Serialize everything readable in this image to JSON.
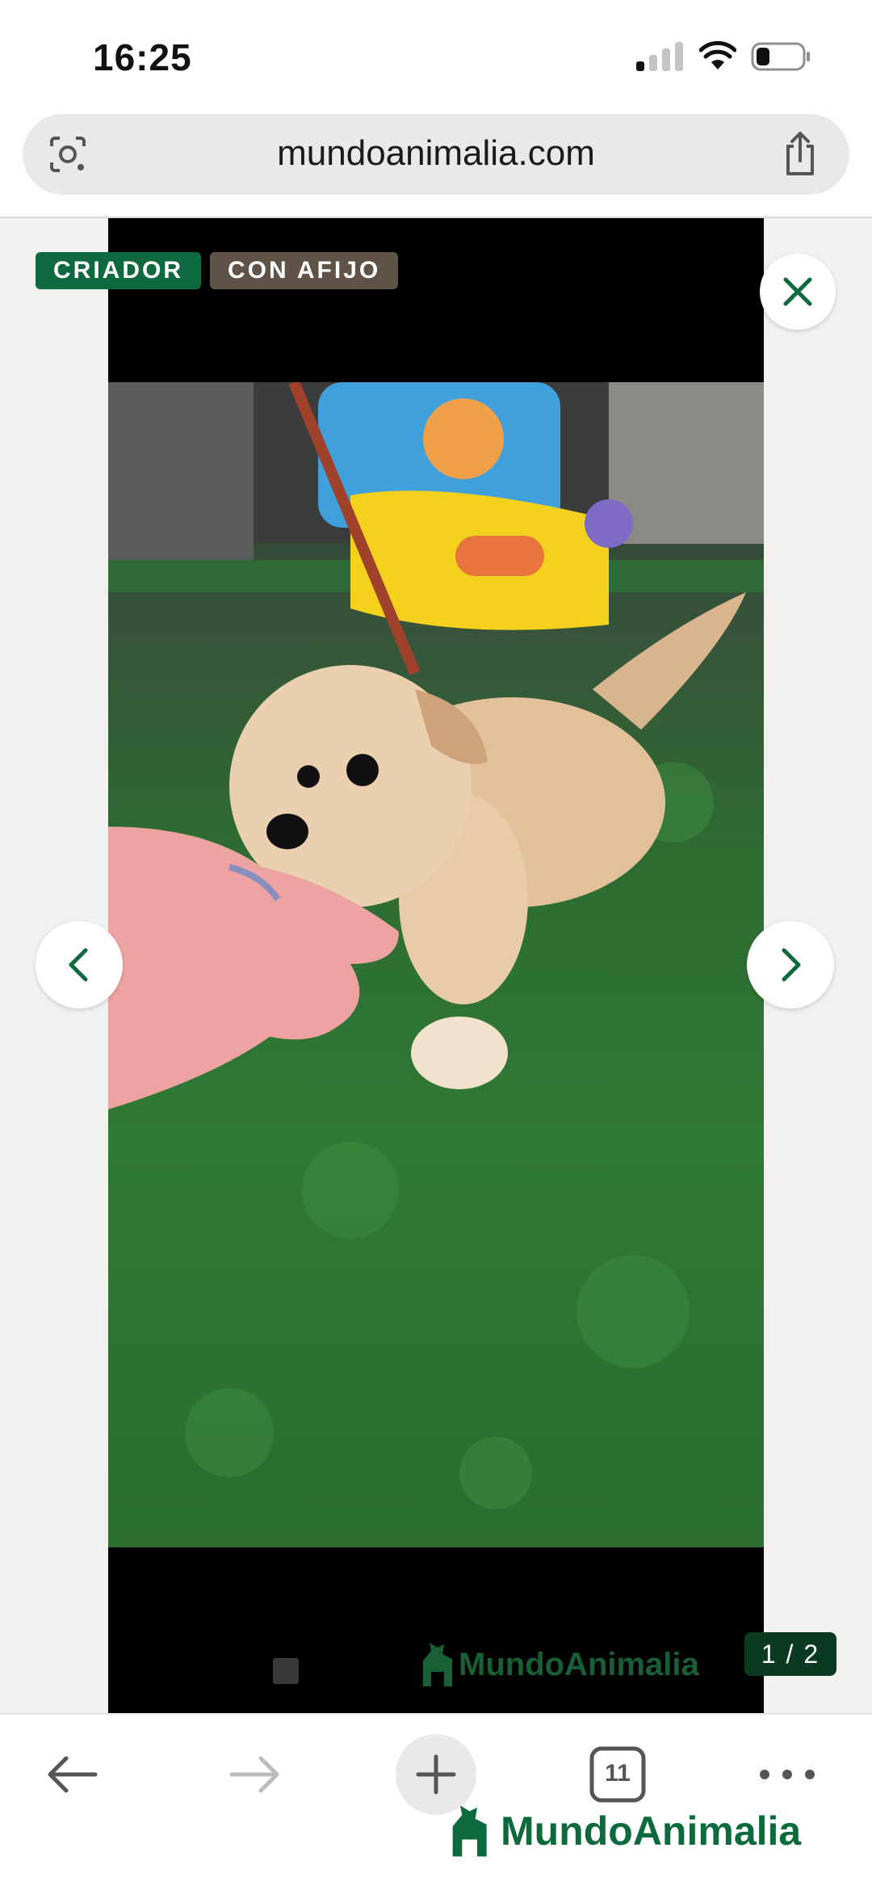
{
  "status_bar": {
    "time": "16:25",
    "signal_bars_on": 1,
    "battery_level": 0.25
  },
  "browser": {
    "url": "mundoanimalia.com",
    "open_tabs": "11"
  },
  "gallery": {
    "badges": [
      "CRIADOR",
      "CON AFIJO"
    ],
    "counter": "1 / 2",
    "watermark": "MundoAnimalia"
  },
  "footer": {
    "logo_text": "MundoAnimalia"
  },
  "colors": {
    "brand_green": "#0e6a3e",
    "badge_brown": "#5f5247",
    "counter_bg": "#0b3a22"
  },
  "icons": [
    "google-lens-icon",
    "share-icon",
    "close-icon",
    "chevron-left-icon",
    "chevron-right-icon",
    "back-arrow-icon",
    "forward-arrow-icon",
    "plus-icon",
    "tabs-icon",
    "more-icon"
  ]
}
